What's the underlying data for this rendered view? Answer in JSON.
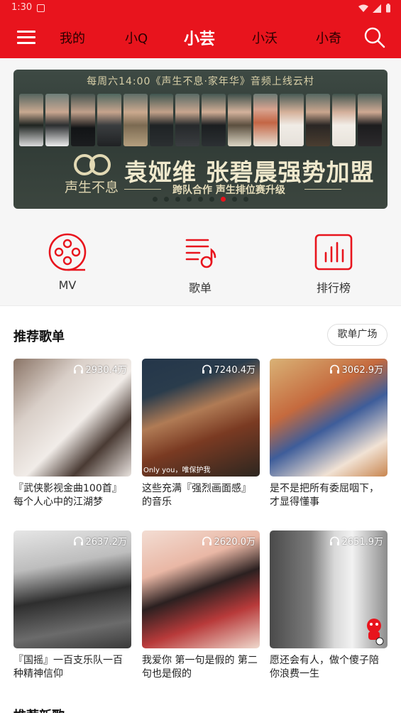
{
  "status_bar": {
    "time": "1:30"
  },
  "nav": {
    "tabs": [
      {
        "label": "我的",
        "active": false
      },
      {
        "label": "小Q",
        "active": false
      },
      {
        "label": "小芸",
        "active": true
      },
      {
        "label": "小沃",
        "active": false
      },
      {
        "label": "小奇",
        "active": false
      }
    ]
  },
  "banner": {
    "top_text": "每周六14:00《声生不息·家年华》音频上线云村",
    "logo_text": "声生不息",
    "headline": "袁娅维 张碧晨强势加盟",
    "subline": "跨队合作 声生排位赛升级",
    "dot_count": 9,
    "active_dot": 6
  },
  "quick_entries": [
    {
      "label": "MV",
      "icon": "mv-reel-icon"
    },
    {
      "label": "歌单",
      "icon": "playlist-icon"
    },
    {
      "label": "排行榜",
      "icon": "chart-icon"
    }
  ],
  "recommend": {
    "title": "推荐歌单",
    "more_button": "歌单广场",
    "playlists": [
      {
        "plays": "2930.4万",
        "title": "『武侠影视金曲100首』每个人心中的江湖梦",
        "caption": ""
      },
      {
        "plays": "7240.4万",
        "title": "这些充满『强烈画面感』的音乐",
        "caption": "Only you，唯保护我"
      },
      {
        "plays": "3062.9万",
        "title": "是不是把所有委屈咽下，才显得懂事",
        "caption": ""
      },
      {
        "plays": "2637.2万",
        "title": "『国摇』一百支乐队一百种精神信仰",
        "caption": ""
      },
      {
        "plays": "2620.0万",
        "title": "我爱你 第一句是假的 第二句也是假的",
        "caption": ""
      },
      {
        "plays": "2651.9万",
        "title": "愿还会有人，做个傻子陪你浪费一生",
        "caption": ""
      }
    ]
  },
  "next_section": {
    "title": "推荐新歌"
  },
  "colors": {
    "brand_red": "#e8141d"
  }
}
